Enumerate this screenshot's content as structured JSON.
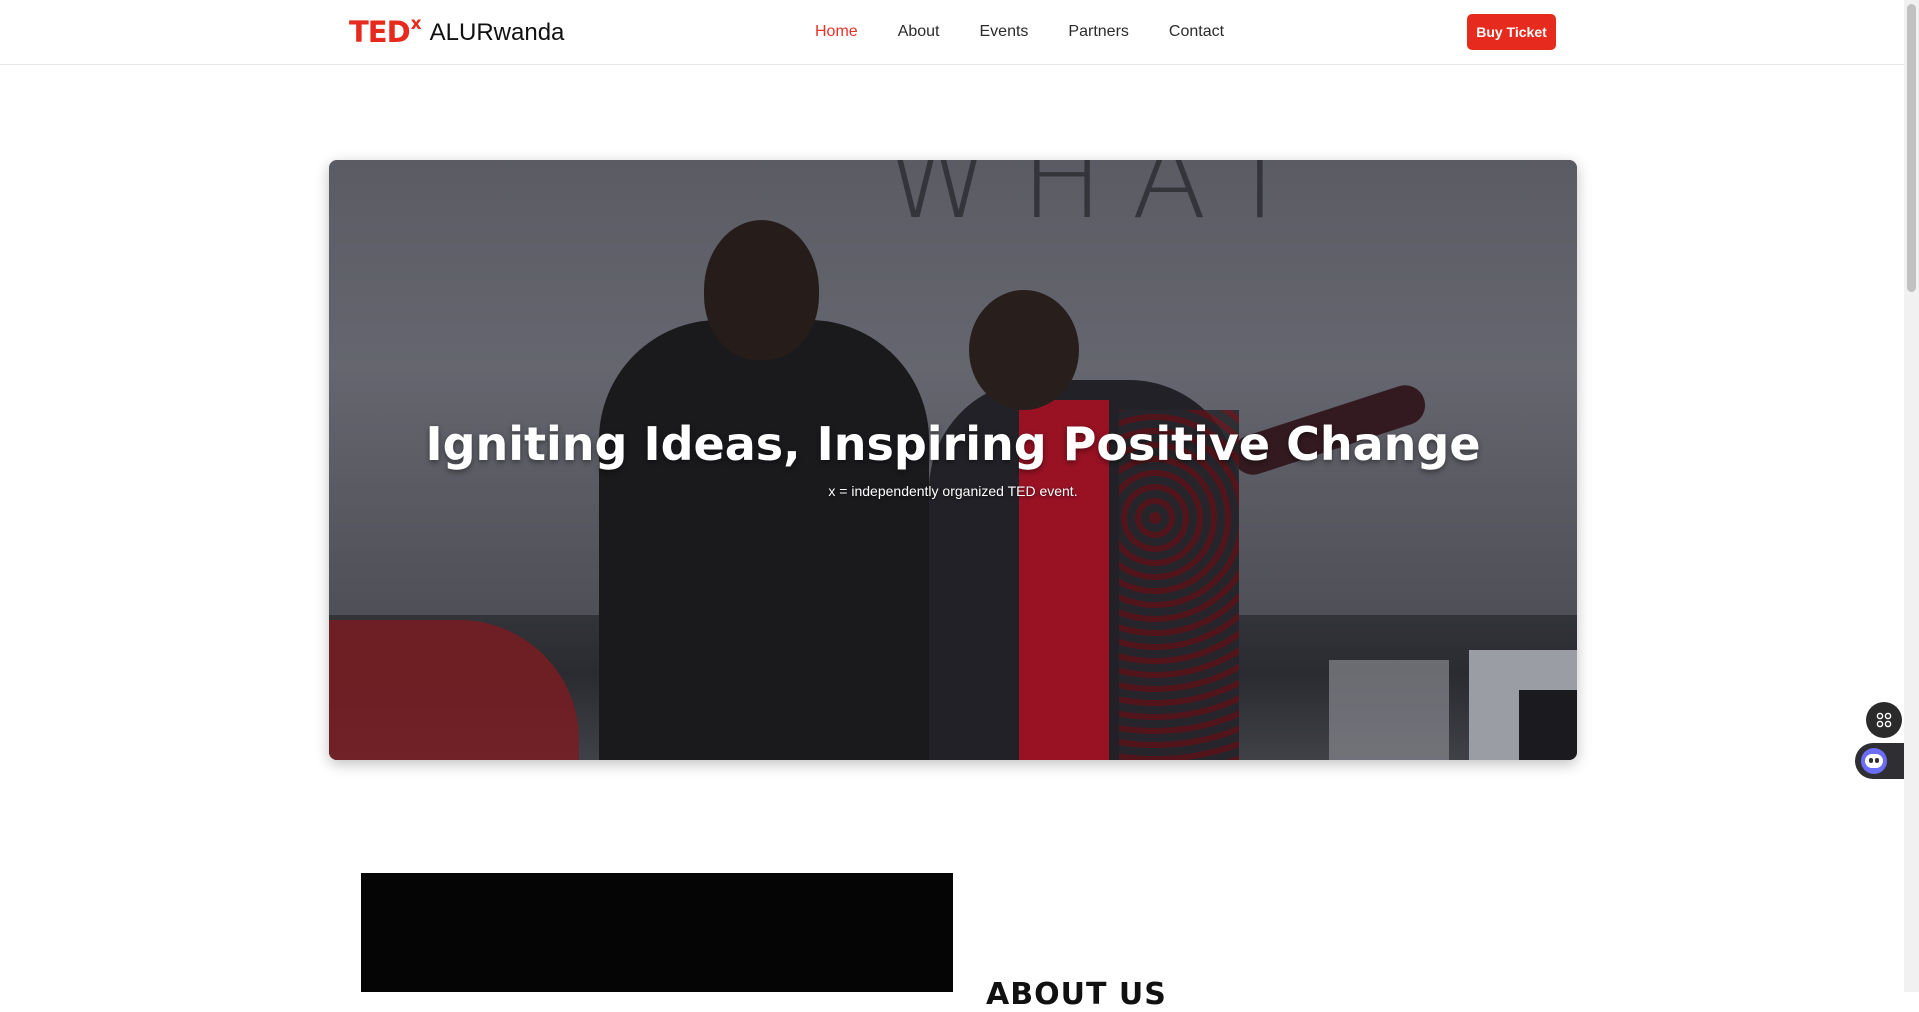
{
  "header": {
    "logo": {
      "ted": "TED",
      "x": "x",
      "name": "ALURwanda"
    },
    "nav": [
      {
        "label": "Home",
        "active": true
      },
      {
        "label": "About",
        "active": false
      },
      {
        "label": "Events",
        "active": false
      },
      {
        "label": "Partners",
        "active": false
      },
      {
        "label": "Contact",
        "active": false
      }
    ],
    "buy_button": "Buy Ticket"
  },
  "hero": {
    "title": "Igniting Ideas, Inspiring Positive Change",
    "subtitle": "x = independently organized TED event.",
    "background_letters": "WHAT"
  },
  "about": {
    "heading": "ABOUT US"
  },
  "floating": {
    "apps_icon": "grid-icon",
    "assistant_icon": "robot-icon"
  },
  "colors": {
    "brand_red": "#e62b1e",
    "nav_active": "#e5342a"
  }
}
